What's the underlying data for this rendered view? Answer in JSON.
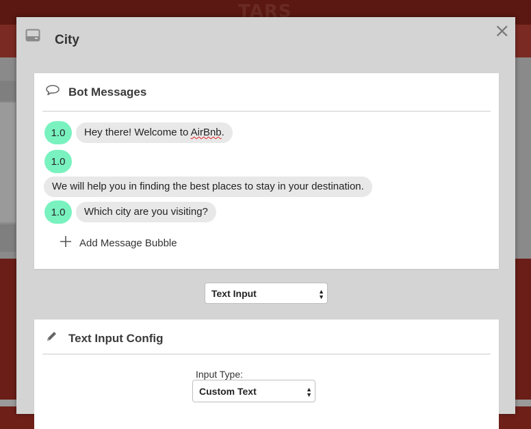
{
  "background": {
    "logo": "TARS"
  },
  "modal": {
    "title": "City",
    "close_label": "×",
    "title_icon": "device-icon"
  },
  "bot_messages": {
    "title": "Bot Messages",
    "icon": "speech-bubble-icon",
    "messages": [
      {
        "version": "1.0",
        "text_pre": "Hey there! Welcome to ",
        "text_misspelled": "AirBnb",
        "text_post": "."
      },
      {
        "version": "1.0",
        "text": "We will help you in finding the best places to stay in your destination."
      },
      {
        "version": "1.0",
        "text": "Which city are you visiting?"
      }
    ],
    "add_label": "Add Message Bubble"
  },
  "input_select": {
    "selected": "Text Input"
  },
  "text_input_config": {
    "title": "Text Input Config",
    "icon": "pencil-icon",
    "input_type_label": "Input Type:",
    "input_type_selected": "Custom Text"
  },
  "colors": {
    "version_badge": "#79f2c0",
    "bubble": "#e8e8e8",
    "modal_bg": "#d4d4d4"
  }
}
